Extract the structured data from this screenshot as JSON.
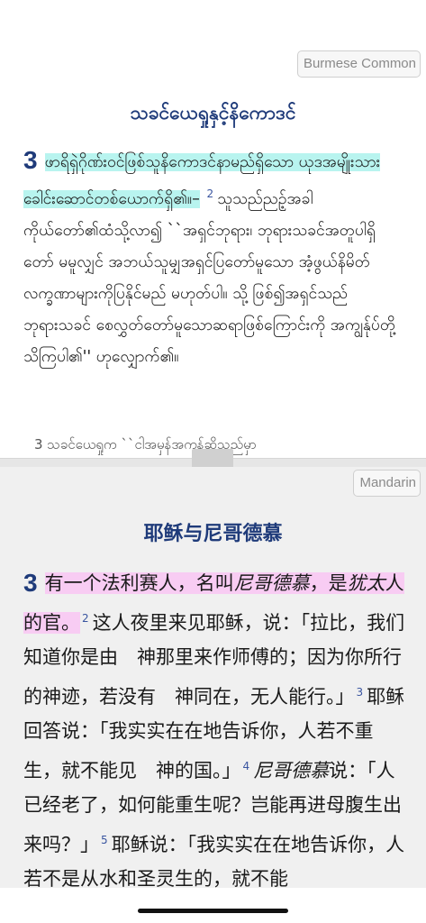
{
  "top": {
    "language_button": "Burmese Common",
    "heading": "သခင်ယေရှုနှင့်နိကောဒင်",
    "chapter": "3",
    "verse1_highlight": "ဖာရိရှဲဂိုဏ်းဝင်ဖြစ်သူနိကောဒင်နာမည်ရှိသော ယုဒအမျိုးသားခေါင်းဆောင်တစ်ယောက်ရှိ၏။–",
    "verse2_num": "2",
    "verse2_text": "သူသည်ညဥ့်အခါကိုယ်တော်၏ထံသို့လာ၍ ``အရှင်ဘုရား၊ ဘုရားသခင်အတူပါရှိတော် မမူလျှင် အဘယ်သူမျှအရှင်ပြတော်မူသော အံ့ဖွယ်နိမိတ်လက္ခဏာများကိုပြနိုင်မည် မဟုတ်ပါ။ သို့ ဖြစ်၍အရှင်သည်ဘုရားသခင် စေလွှတ်တော်မူသောဆရာဖြစ်ကြောင်းကို အကျွန်ုပ်တို့သိကြပါ၏'' ဟုလျှောက်၏။",
    "verse3_cut": "3 သခင်ယေရှုက ``ငါအမှန်အကန်ဆိုသည်မှာ"
  },
  "bottom": {
    "language_button": "Mandarin",
    "heading": "耶稣与尼哥德慕",
    "chapter": "3",
    "v1_a": "有一个法利赛人，名叫",
    "v1_b": "尼哥德慕",
    "v1_c": "，是",
    "v1_d": "犹太",
    "v1_e": "人的官。",
    "v2_num": "2",
    "v2_text": "这人夜里来见耶稣，说：「拉比，我们知道你是由　神那里来作师傅的；因为你所行的神迹，若没有　神同在，无人能行。」",
    "v3_num": "3",
    "v3_text": "耶稣回答说：「我实实在在地告诉你，人若不重生，就不能见　神的国。」",
    "v4_num": "4",
    "v4_name": "尼哥德慕",
    "v4_text": "说：「人已经老了，如何能重生呢？岂能再进母腹生出来吗？」",
    "v5_num": "5",
    "v5_text": "耶稣说：「我实实在在地告诉你，人若不是从水和圣灵生的，就不能"
  },
  "colors": {
    "heading": "#1f3b7a",
    "highlight_cyan": "#b8f4ef",
    "highlight_pink": "#f8ccf3",
    "bottom_background": "#f0f0f0"
  }
}
